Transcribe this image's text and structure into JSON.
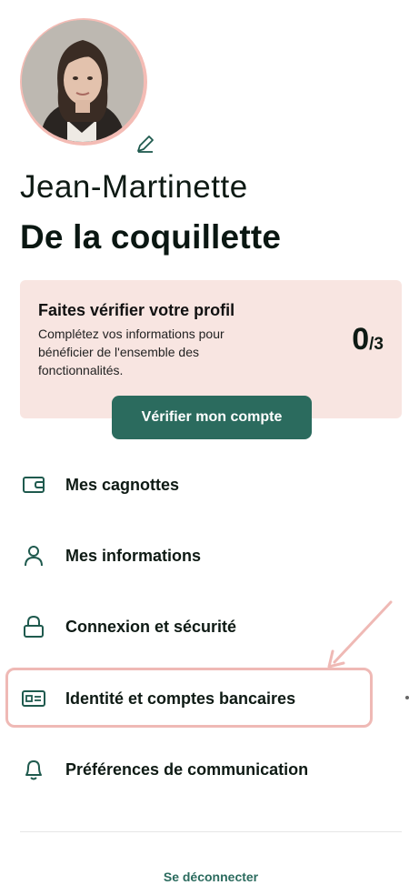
{
  "profile": {
    "first_name": "Jean-Martinette",
    "last_name": "De la coquillette"
  },
  "verification": {
    "title": "Faites vérifier votre profil",
    "description": "Complétez vos informations pour bénéficier de l'ensemble des fonctionnalités.",
    "count": "0",
    "total": "/3",
    "button_label": "Vérifier mon compte"
  },
  "menu": {
    "items": [
      {
        "label": "Mes cagnottes",
        "icon": "wallet-icon"
      },
      {
        "label": "Mes informations",
        "icon": "user-icon"
      },
      {
        "label": "Connexion et sécurité",
        "icon": "lock-icon"
      },
      {
        "label": "Identité et comptes bancaires",
        "icon": "id-card-icon"
      },
      {
        "label": "Préférences de communication",
        "icon": "bell-icon"
      }
    ]
  },
  "logout_label": "Se déconnecter",
  "colors": {
    "accent": "#2b6b5e",
    "card_bg": "#f8e5e1",
    "highlight": "#efb9b5"
  }
}
